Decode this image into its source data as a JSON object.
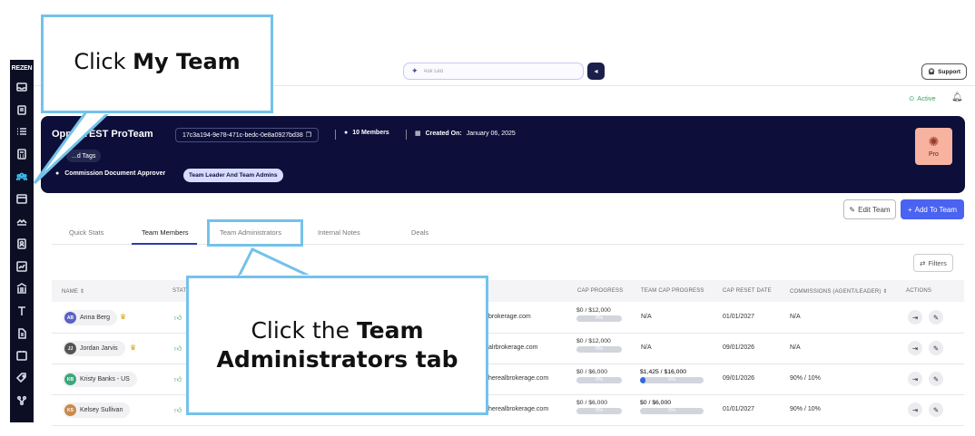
{
  "sidebar": {
    "logo": "REZEN",
    "active_index": 7
  },
  "search": {
    "placeholder": "Ask Leo"
  },
  "header": {
    "support_label": "Support",
    "status": "Active"
  },
  "banner": {
    "team_name": "Opp... TEST ProTeam",
    "team_id": "17c3a194-9e78-471c-bedc-0e8a0927bd38",
    "members": "10 Members",
    "created_label": "Created On:",
    "created_value": "January 06, 2025",
    "tags": "...d Tags",
    "approver_label": "Commission Document Approver",
    "approver_value": "Team Leader And Team Admins",
    "plan_badge": "Pro"
  },
  "actions": {
    "edit_label": "Edit Team",
    "add_label": "Add To Team",
    "filters_label": "Filters"
  },
  "tabs": [
    "Quick Stats",
    "Team Members",
    "Team Administrators",
    "Internal Notes",
    "Deals"
  ],
  "table": {
    "headers": {
      "name": "NAME",
      "status": "STAT",
      "cap_progress": "CAP PROGRESS",
      "team_cap_progress": "TEAM CAP PROGRESS",
      "cap_reset": "CAP RESET DATE",
      "commissions": "COMMISSIONS (AGENT/LEADER)",
      "actions": "ACTIONS"
    },
    "rows": [
      {
        "initials": "AB",
        "name": "Anna Berg",
        "email": "brokerage.com",
        "cap": "$0 / $12,000",
        "cap_pct": "0%",
        "cap_fill": 0,
        "team_cap": "N/A",
        "team_cap_pct": "",
        "team_cap_fill": 0,
        "reset": "01/01/2027",
        "commissions": "N/A"
      },
      {
        "initials": "JJ",
        "name": "Jordan Jarvis",
        "email": "alrbrokerage.com",
        "cap": "$0 / $12,000",
        "cap_pct": "0%",
        "cap_fill": 0,
        "team_cap": "N/A",
        "team_cap_pct": "",
        "team_cap_fill": 0,
        "reset": "09/01/2026",
        "commissions": "N/A"
      },
      {
        "initials": "KB",
        "name": "Kristy Banks - US",
        "email": "herealbrokerage.com",
        "cap": "$0 / $6,000",
        "cap_pct": "0%",
        "cap_fill": 0,
        "team_cap": "$1,425 / $16,000",
        "team_cap_pct": "9%",
        "team_cap_fill": 0.09,
        "reset": "09/01/2026",
        "commissions": "90% / 10%"
      },
      {
        "initials": "KS",
        "name": "Kelsey Sullivan",
        "email": "herealbrokerage.com",
        "cap": "$0 / $6,000",
        "cap_pct": "0%",
        "cap_fill": 0,
        "team_cap": "$0 / $6,000",
        "team_cap_pct": "0%",
        "team_cap_fill": 0,
        "reset": "01/01/2027",
        "commissions": "90% / 10%"
      }
    ]
  },
  "callouts": {
    "c1_prefix": "Click ",
    "c1_bold": "My Team",
    "c2_prefix": "Click the ",
    "c2_bold1": "Team",
    "c2_bold2": "Administrators tab"
  },
  "colors": {
    "navy": "#0d0f3a",
    "accent": "#4a63f0",
    "callout_border": "#73c2ea",
    "pro_badge": "#f7b2a0"
  }
}
